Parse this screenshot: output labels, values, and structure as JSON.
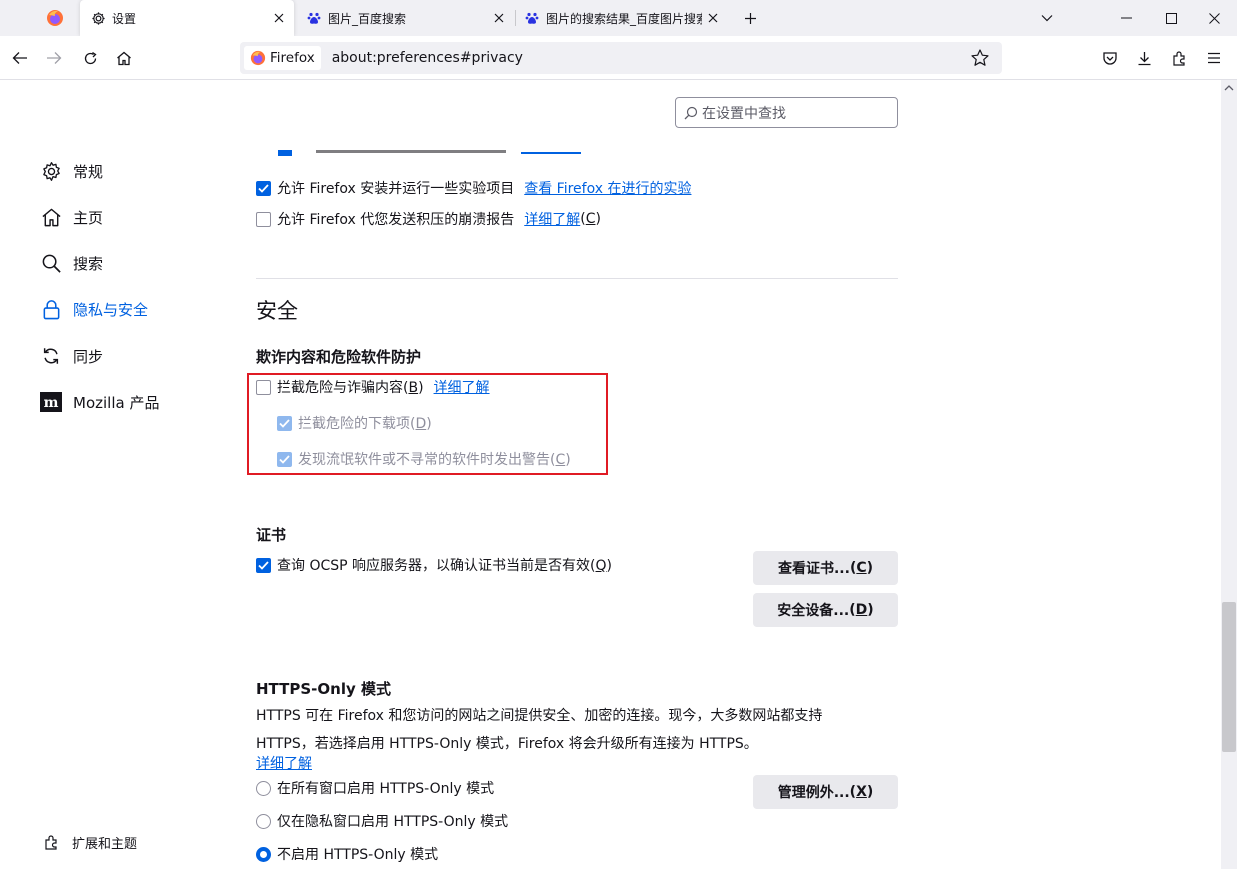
{
  "tabs": [
    {
      "title": "设置",
      "icon": "gear-icon",
      "active": true
    },
    {
      "title": "图片_百度搜索",
      "icon": "baidu-paw-icon",
      "active": false
    },
    {
      "title": "图片的搜索结果_百度图片搜索",
      "icon": "baidu-paw-icon",
      "active": false
    }
  ],
  "urlbar": {
    "identity_label": "Firefox",
    "url": "about:preferences#privacy"
  },
  "search": {
    "placeholder": "在设置中查找"
  },
  "sidebar": {
    "items": [
      {
        "label": "常规",
        "icon": "gear-icon"
      },
      {
        "label": "主页",
        "icon": "home-icon"
      },
      {
        "label": "搜索",
        "icon": "search-icon"
      },
      {
        "label": "隐私与安全",
        "icon": "lock-icon",
        "selected": true
      },
      {
        "label": "同步",
        "icon": "sync-icon"
      },
      {
        "label": "Mozilla 产品",
        "icon": "mozilla-icon"
      }
    ],
    "extensions_label": "扩展和主题"
  },
  "data_collection": {
    "studies": {
      "label": "允许 Firefox 安装并运行一些实验项目",
      "link": "查看 Firefox 在进行的实验",
      "checked": true
    },
    "crash_reports": {
      "label": "允许 Firefox 代您发送积压的崩溃报告",
      "link": "详细了解",
      "accesskey": "C",
      "checked": false
    }
  },
  "security": {
    "heading": "安全",
    "phishing_heading": "欺诈内容和危险软件防护",
    "block_dangerous": {
      "label": "拦截危险与诈骗内容",
      "accesskey": "B",
      "link": "详细了解",
      "checked": false
    },
    "block_downloads": {
      "label": "拦截危险的下载项",
      "accesskey": "D",
      "checked": true
    },
    "warn_unwanted": {
      "label": "发现流氓软件或不寻常的软件时发出警告",
      "accesskey": "C",
      "checked": true
    }
  },
  "certificates": {
    "heading": "证书",
    "ocsp": {
      "label": "查询 OCSP 响应服务器，以确认证书当前是否有效",
      "accesskey": "Q",
      "checked": true
    },
    "view_button": "查看证书...",
    "view_accesskey": "C",
    "devices_button": "安全设备...",
    "devices_accesskey": "D"
  },
  "https_only": {
    "heading": "HTTPS-Only 模式",
    "desc_line1": "HTTPS 可在 Firefox 和您访问的网站之间提供安全、加密的连接。现今，大多数网站都支持",
    "desc_line2": "HTTPS，若选择启用 HTTPS-Only 模式，Firefox 将会升级所有连接为 HTTPS。",
    "learn_more": "详细了解",
    "options": [
      {
        "label": "在所有窗口启用 HTTPS-Only 模式",
        "selected": false
      },
      {
        "label": "仅在隐私窗口启用 HTTPS-Only 模式",
        "selected": false
      },
      {
        "label": "不启用 HTTPS-Only 模式",
        "selected": true
      }
    ],
    "exceptions_button": "管理例外...",
    "exceptions_accesskey": "X"
  },
  "colors": {
    "accent": "#0061e0",
    "highlight_box": "#e01b24",
    "button_bg": "#e9e9ed"
  }
}
